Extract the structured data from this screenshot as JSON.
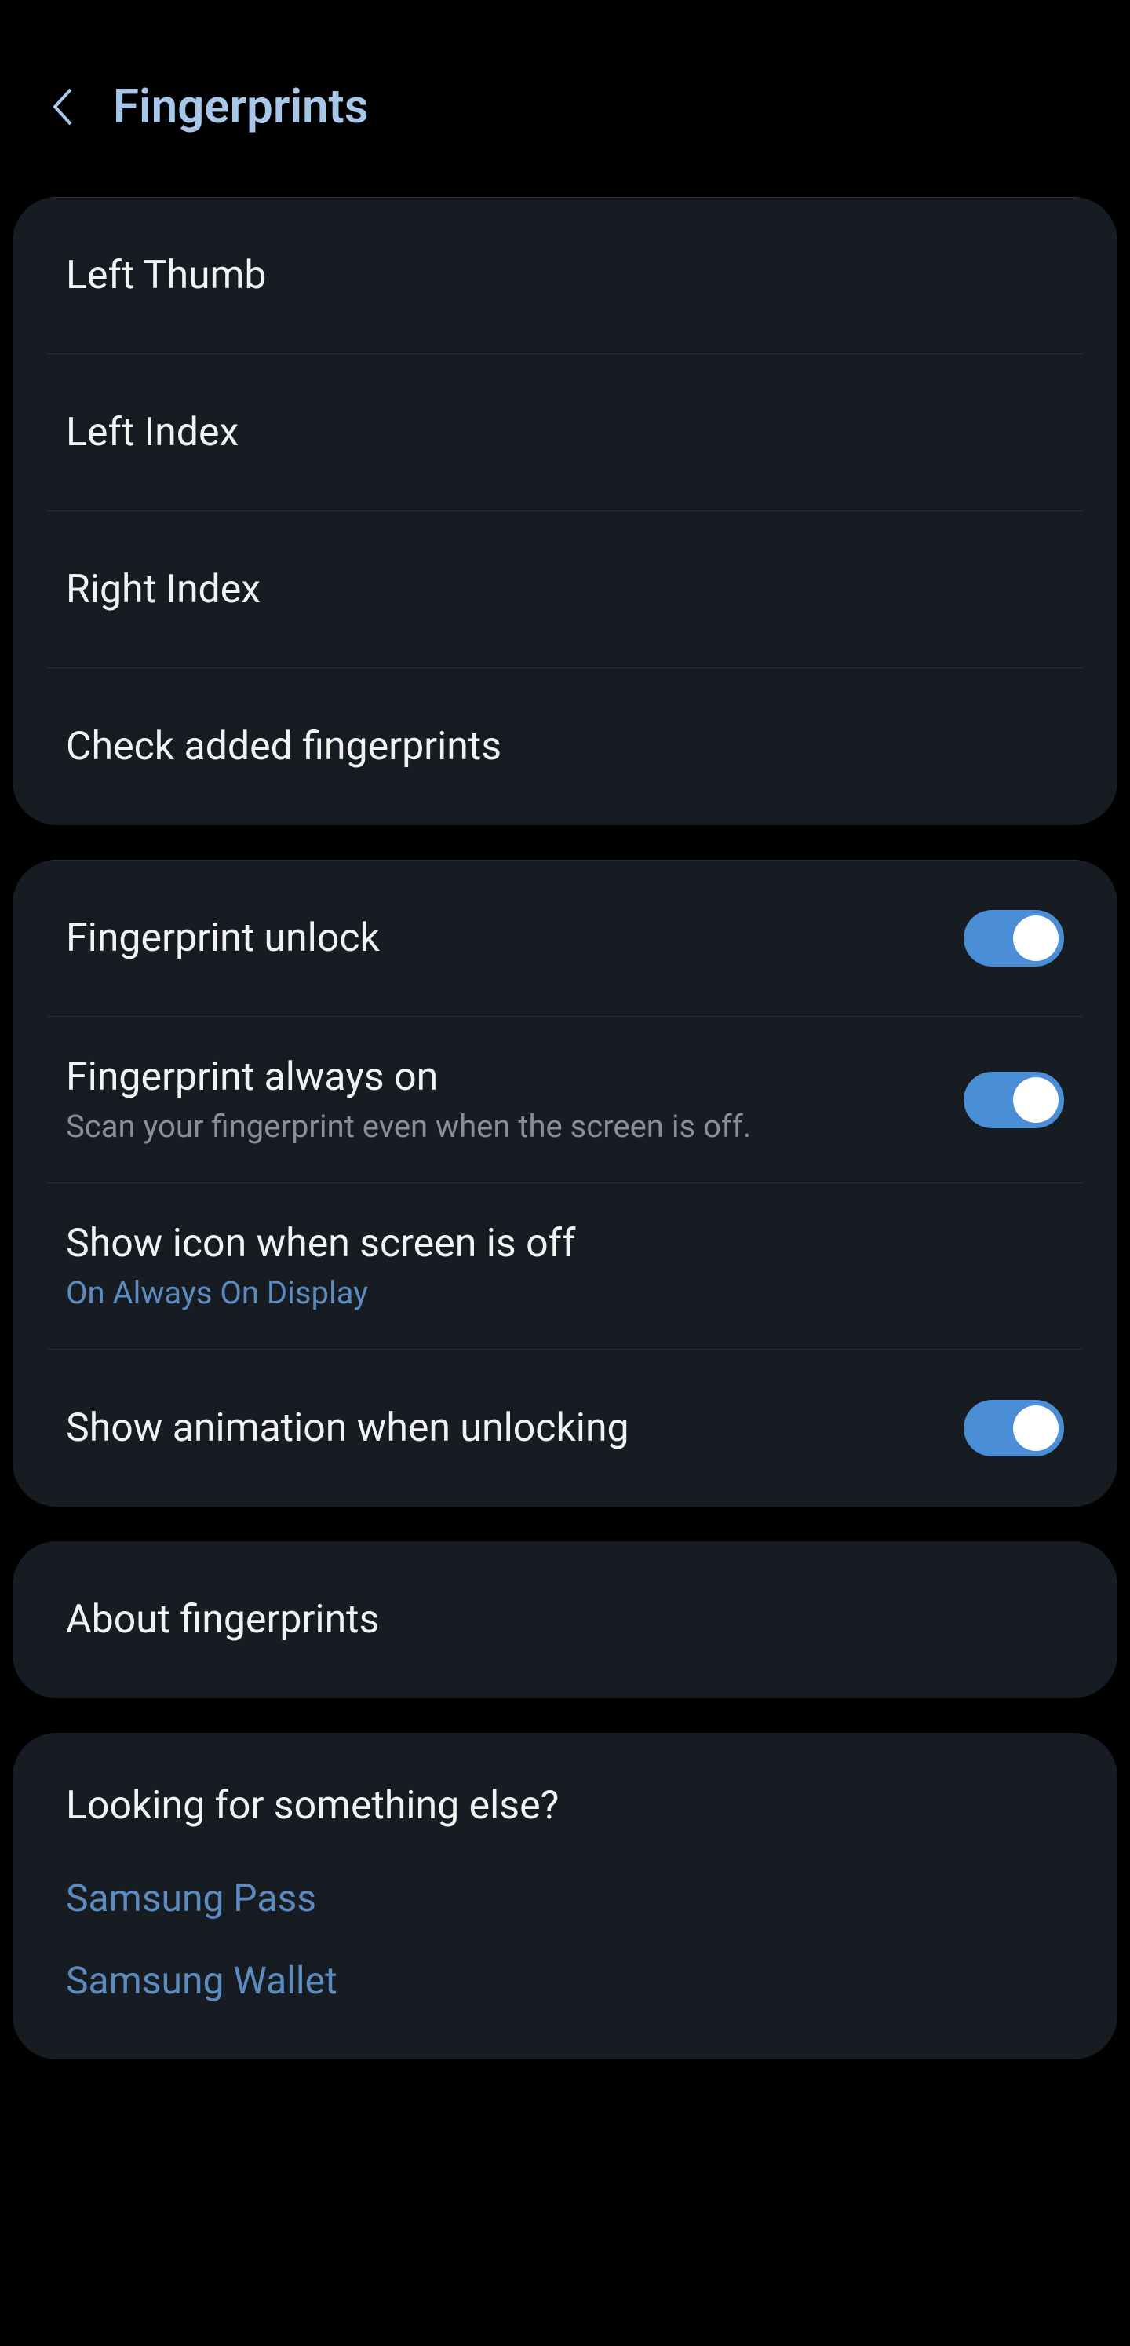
{
  "header": {
    "title": "Fingerprints"
  },
  "fingerprints_card": {
    "items": [
      {
        "label": "Left Thumb"
      },
      {
        "label": "Left Index"
      },
      {
        "label": "Right Index"
      },
      {
        "label": "Check added fingerprints"
      }
    ]
  },
  "settings_card": {
    "items": [
      {
        "title": "Fingerprint unlock",
        "toggle": true
      },
      {
        "title": "Fingerprint always on",
        "subtitle": "Scan your fingerprint even when the screen is off.",
        "toggle": true
      },
      {
        "title": "Show icon when screen is off",
        "subtitle": "On Always On Display",
        "subtitle_accent": true
      },
      {
        "title": "Show animation when unlocking",
        "toggle": true
      }
    ]
  },
  "about_card": {
    "title": "About fingerprints"
  },
  "related_card": {
    "header": "Looking for something else?",
    "links": [
      {
        "label": "Samsung Pass"
      },
      {
        "label": "Samsung Wallet"
      }
    ]
  }
}
